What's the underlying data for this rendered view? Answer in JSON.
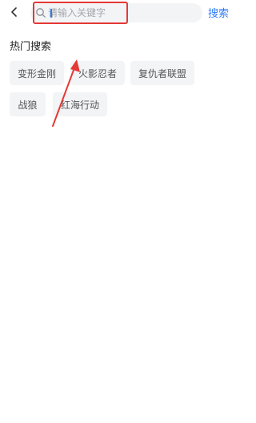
{
  "header": {
    "back_icon": "chevron-left-icon",
    "search": {
      "icon": "search-icon",
      "placeholder": "请输入关键字",
      "value": ""
    },
    "search_button_label": "搜索"
  },
  "hot_search": {
    "title": "热门搜索",
    "tags": [
      {
        "label": "变形金刚"
      },
      {
        "label": "火影忍者"
      },
      {
        "label": "复仇者联盟"
      },
      {
        "label": "战狼"
      },
      {
        "label": "红海行动"
      }
    ]
  },
  "colors": {
    "accent": "#2f7cf6",
    "annotation": "#e53935",
    "tag_bg": "#f3f4f6"
  }
}
